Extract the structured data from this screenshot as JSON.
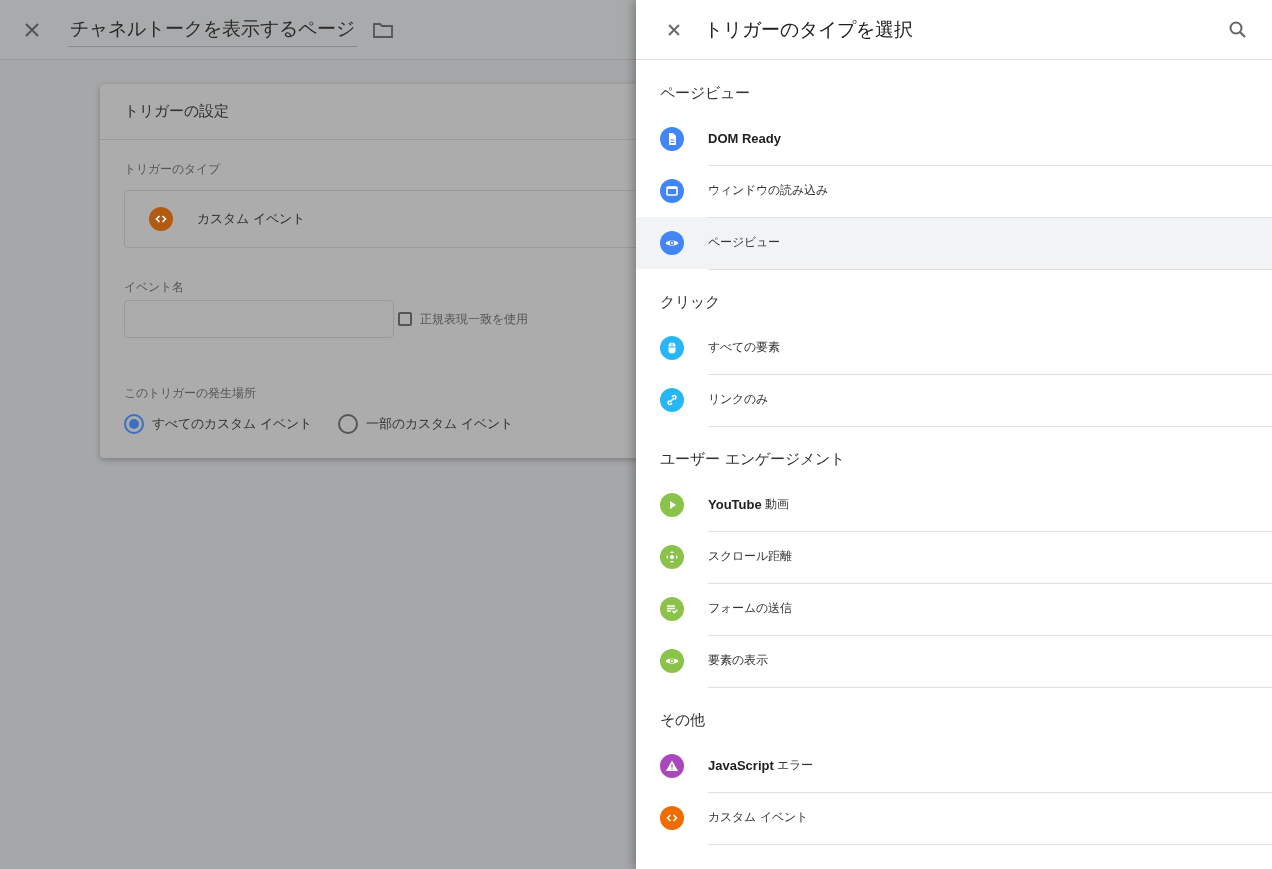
{
  "page": {
    "title": "チャネルトークを表示するページ"
  },
  "trigger_config": {
    "heading": "トリガーの設定",
    "type_label": "トリガーのタイプ",
    "type_value": "カスタム イベント",
    "event_name_label": "イベント名",
    "regex": {
      "label": "正規表現一致を使用",
      "checked": false
    },
    "fires_on_label": "このトリガーの発生場所",
    "fires_on_options": [
      {
        "label": "すべてのカスタム イベント",
        "selected": true
      },
      {
        "label": "一部のカスタム イベント",
        "selected": false
      }
    ]
  },
  "drawer": {
    "title": "トリガーのタイプを選択",
    "sections": [
      {
        "heading": "ページビュー",
        "items": [
          {
            "label": "**DOM Ready**",
            "kind": "document",
            "color": "#4285f4",
            "highlighted": false
          },
          {
            "label": "ウィンドウの読み込み",
            "kind": "window",
            "color": "#4285f4",
            "highlighted": false
          },
          {
            "label": "ページビュー",
            "kind": "eye",
            "color": "#4285f4",
            "highlighted": true
          }
        ]
      },
      {
        "heading": "クリック",
        "items": [
          {
            "label": "すべての要素",
            "kind": "mouse",
            "color": "#29b6f6",
            "highlighted": false
          },
          {
            "label": "リンクのみ",
            "kind": "link",
            "color": "#29b6f6",
            "highlighted": false
          }
        ]
      },
      {
        "heading": "ユーザー エンゲージメント",
        "items": [
          {
            "label": "**YouTube** 動画",
            "kind": "play",
            "color": "#8bc34a",
            "highlighted": false
          },
          {
            "label": "スクロール距離",
            "kind": "move",
            "color": "#8bc34a",
            "highlighted": false
          },
          {
            "label": "フォームの送信",
            "kind": "form",
            "color": "#8bc34a",
            "highlighted": false
          },
          {
            "label": "要素の表示",
            "kind": "eye",
            "color": "#8bc34a",
            "highlighted": false
          }
        ]
      },
      {
        "heading": "その他",
        "items": [
          {
            "label": "**JavaScript** エラー",
            "kind": "warning",
            "color": "#ab47bc",
            "highlighted": false
          },
          {
            "label": "カスタム イベント",
            "kind": "code",
            "color": "#ef6c00",
            "highlighted": false
          }
        ]
      }
    ]
  }
}
